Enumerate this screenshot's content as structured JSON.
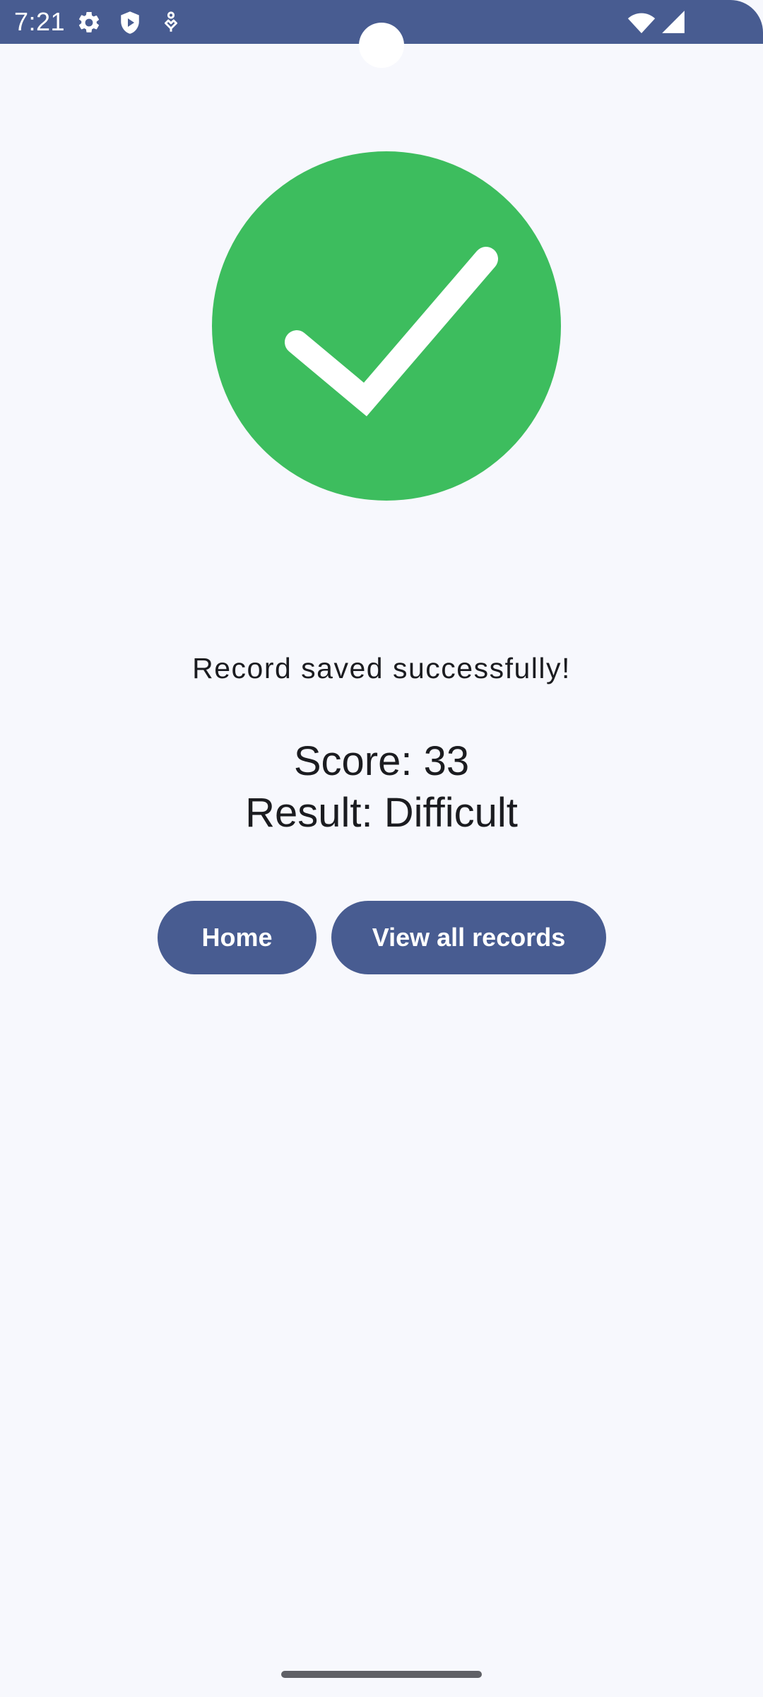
{
  "status_bar": {
    "time": "7:21",
    "left_icons": [
      "gear-icon",
      "shield-play-icon",
      "accessibility-icon"
    ],
    "right_icons": [
      "wifi-icon",
      "cellular-signal-icon"
    ],
    "background_color": "#485c91"
  },
  "success": {
    "icon": "check-circle-icon",
    "color": "#3dbd5e",
    "message": "Record saved successfully!"
  },
  "summary": {
    "score_text": "Score: 33",
    "result_text": "Result: Difficult"
  },
  "actions": {
    "home_label": "Home",
    "view_records_label": "View all records",
    "button_color": "#485c91"
  }
}
